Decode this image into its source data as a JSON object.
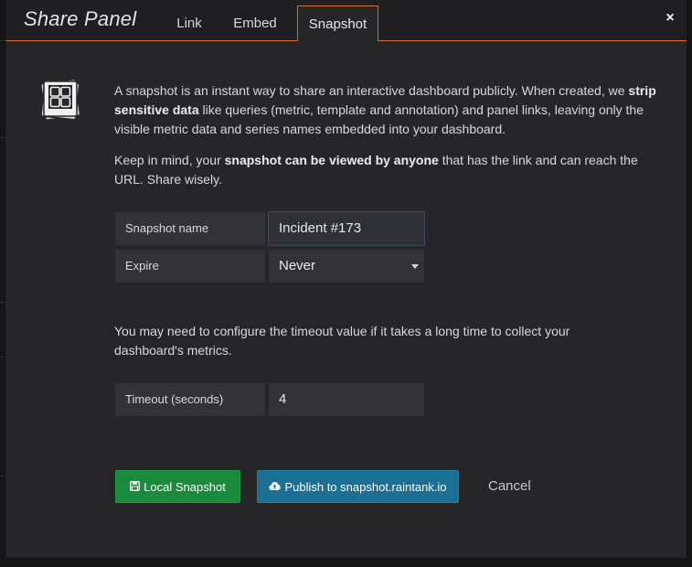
{
  "modal": {
    "title": "Share Panel",
    "close_label": "×"
  },
  "tabs": [
    {
      "label": "Link"
    },
    {
      "label": "Embed"
    },
    {
      "label": "Snapshot",
      "active": true
    }
  ],
  "description": {
    "para1_a": "A snapshot is an instant way to share an interactive dashboard publicly. When created, we ",
    "para1_b": "strip sensitive data",
    "para1_c": " like queries (metric, template and annotation) and panel links, leaving only the visible metric data and series names embedded into your dashboard.",
    "para2_a": "Keep in mind, your ",
    "para2_b": "snapshot can be viewed by anyone",
    "para2_c": " that has the link and can reach the URL. Share wisely."
  },
  "form": {
    "snapshot_name_label": "Snapshot name",
    "snapshot_name_value": "Incident #173",
    "expire_label": "Expire",
    "expire_value": "Never"
  },
  "timeout_note": "You may need to configure the timeout value if it takes a long time to collect your dashboard's metrics.",
  "timeout": {
    "label": "Timeout (seconds)",
    "value": "4"
  },
  "actions": {
    "local_snapshot_label": "Local Snapshot",
    "publish_label": "Publish to snapshot.raintank.io",
    "cancel_label": "Cancel"
  },
  "colors": {
    "accent": "#d56b2e",
    "local_button": "#1a8a3c",
    "publish_button": "#1a6f92"
  },
  "icons": {
    "snapshot": "snapshot-photos-icon",
    "save": "floppy-disk-icon",
    "publish": "cloud-upload-icon",
    "close": "close-icon"
  }
}
